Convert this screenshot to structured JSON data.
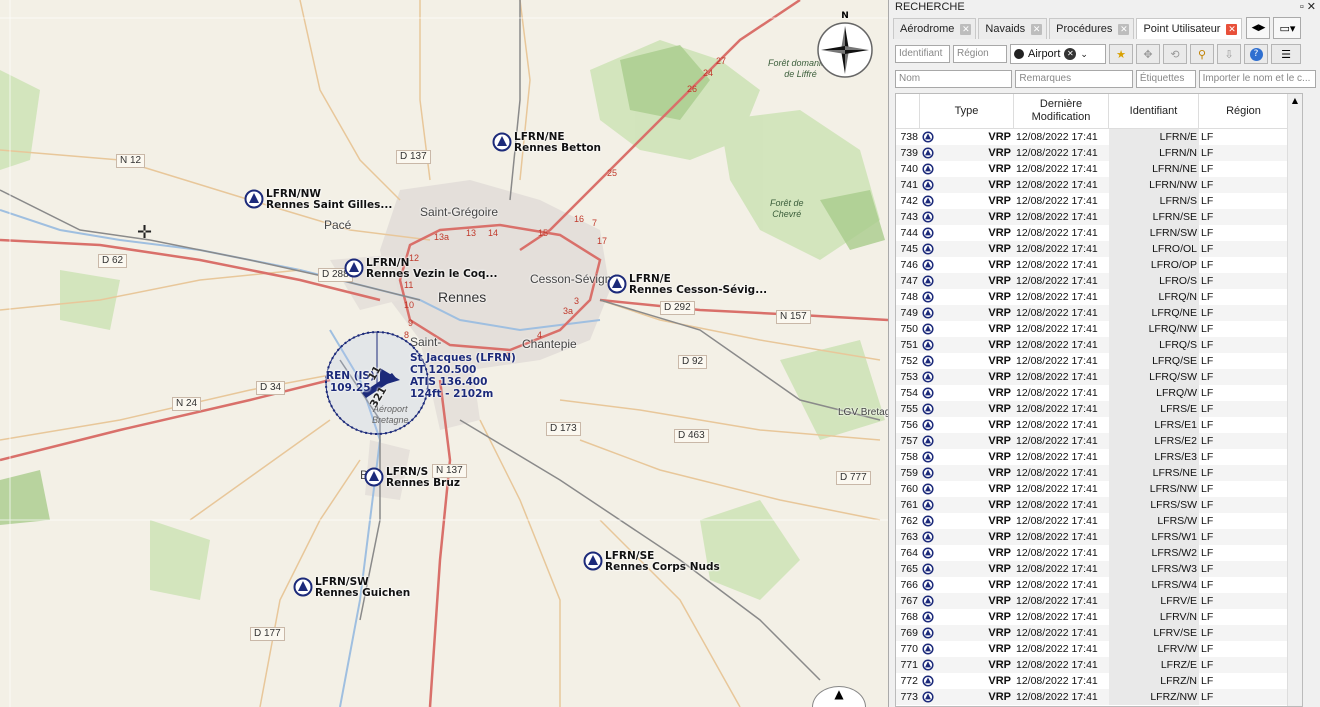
{
  "map": {
    "road_labels": [
      "N 12",
      "D 137",
      "D 62",
      "D 288",
      "D 292",
      "N 157",
      "D 92",
      "D 34",
      "N 24",
      "D 173",
      "D 463",
      "N 137",
      "D 777",
      "D 177"
    ],
    "towns": {
      "pace": "Pacé",
      "saint_gregoire": "Saint-Grégoire",
      "rennes": "Rennes",
      "cesson": "Cesson-Sévigné",
      "chantepie": "Chantepie",
      "saint": "Saint-",
      "lgv": "LGV Bretag",
      "bru": "B"
    },
    "km_markers": [
      "27",
      "26",
      "24",
      "25",
      "16",
      "17",
      "15",
      "14",
      "13",
      "13a",
      "12",
      "11",
      "10",
      "8",
      "9",
      "3",
      "3a",
      "4",
      "5",
      "7"
    ],
    "forests": {
      "liffre": "Forêt domaniale\nde Liffré",
      "chevre": "Forêt de\nChevré"
    },
    "vrp_points": [
      {
        "code": "LFRN/NE",
        "name": "Rennes Betton"
      },
      {
        "code": "LFRN/NW",
        "name": "Rennes Saint Gilles..."
      },
      {
        "code": "LFRN/N",
        "name": "Rennes Vezin le Coq..."
      },
      {
        "code": "LFRN/E",
        "name": "Rennes Cesson-Sévig..."
      },
      {
        "code": "LFRN/S",
        "name": "Rennes Bruz"
      },
      {
        "code": "LFRN/SE",
        "name": "Rennes Corps Nuds"
      },
      {
        "code": "LFRN/SW",
        "name": "Rennes Guichen"
      }
    ],
    "airport": {
      "name": "St Jacques (LFRN)",
      "ct": "CT 120.500",
      "atis": "ATIS 136.400",
      "elev": "124ft - 2102m",
      "navaid_id": "REN (IS)",
      "navaid_freq": "109.25",
      "rwy1": "11",
      "rwy2": "321",
      "area": "Aéroport\nBretagne"
    },
    "compass_label": "N"
  },
  "panel": {
    "title": "RECHERCHE",
    "tabs": [
      {
        "label": "Aérodrome",
        "active": false
      },
      {
        "label": "Navaids",
        "active": false
      },
      {
        "label": "Procédures",
        "active": false
      },
      {
        "label": "Point Utilisateur",
        "active": true
      }
    ],
    "filters": {
      "identifiant_placeholder": "Identifiant",
      "region_placeholder": "Région",
      "type_value": "Airport",
      "nom_placeholder": "Nom",
      "remarques_placeholder": "Remarques",
      "etiquettes_placeholder": "Étiquettes",
      "import_placeholder": "Importer le nom et le c..."
    },
    "table": {
      "headers": {
        "type": "Type",
        "modified": "Dernière\nModification",
        "ident": "Identifiant",
        "region": "Région"
      },
      "rows": [
        {
          "n": "738",
          "type": "VRP",
          "date": "12/08/2022 17:41",
          "id": "LFRN/E",
          "region": "LF"
        },
        {
          "n": "739",
          "type": "VRP",
          "date": "12/08/2022 17:41",
          "id": "LFRN/N",
          "region": "LF"
        },
        {
          "n": "740",
          "type": "VRP",
          "date": "12/08/2022 17:41",
          "id": "LFRN/NE",
          "region": "LF"
        },
        {
          "n": "741",
          "type": "VRP",
          "date": "12/08/2022 17:41",
          "id": "LFRN/NW",
          "region": "LF"
        },
        {
          "n": "742",
          "type": "VRP",
          "date": "12/08/2022 17:41",
          "id": "LFRN/S",
          "region": "LF"
        },
        {
          "n": "743",
          "type": "VRP",
          "date": "12/08/2022 17:41",
          "id": "LFRN/SE",
          "region": "LF"
        },
        {
          "n": "744",
          "type": "VRP",
          "date": "12/08/2022 17:41",
          "id": "LFRN/SW",
          "region": "LF"
        },
        {
          "n": "745",
          "type": "VRP",
          "date": "12/08/2022 17:41",
          "id": "LFRO/OL",
          "region": "LF"
        },
        {
          "n": "746",
          "type": "VRP",
          "date": "12/08/2022 17:41",
          "id": "LFRO/OP",
          "region": "LF"
        },
        {
          "n": "747",
          "type": "VRP",
          "date": "12/08/2022 17:41",
          "id": "LFRO/S",
          "region": "LF"
        },
        {
          "n": "748",
          "type": "VRP",
          "date": "12/08/2022 17:41",
          "id": "LFRQ/N",
          "region": "LF"
        },
        {
          "n": "749",
          "type": "VRP",
          "date": "12/08/2022 17:41",
          "id": "LFRQ/NE",
          "region": "LF"
        },
        {
          "n": "750",
          "type": "VRP",
          "date": "12/08/2022 17:41",
          "id": "LFRQ/NW",
          "region": "LF"
        },
        {
          "n": "751",
          "type": "VRP",
          "date": "12/08/2022 17:41",
          "id": "LFRQ/S",
          "region": "LF"
        },
        {
          "n": "752",
          "type": "VRP",
          "date": "12/08/2022 17:41",
          "id": "LFRQ/SE",
          "region": "LF"
        },
        {
          "n": "753",
          "type": "VRP",
          "date": "12/08/2022 17:41",
          "id": "LFRQ/SW",
          "region": "LF"
        },
        {
          "n": "754",
          "type": "VRP",
          "date": "12/08/2022 17:41",
          "id": "LFRQ/W",
          "region": "LF"
        },
        {
          "n": "755",
          "type": "VRP",
          "date": "12/08/2022 17:41",
          "id": "LFRS/E",
          "region": "LF"
        },
        {
          "n": "756",
          "type": "VRP",
          "date": "12/08/2022 17:41",
          "id": "LFRS/E1",
          "region": "LF"
        },
        {
          "n": "757",
          "type": "VRP",
          "date": "12/08/2022 17:41",
          "id": "LFRS/E2",
          "region": "LF"
        },
        {
          "n": "758",
          "type": "VRP",
          "date": "12/08/2022 17:41",
          "id": "LFRS/E3",
          "region": "LF"
        },
        {
          "n": "759",
          "type": "VRP",
          "date": "12/08/2022 17:41",
          "id": "LFRS/NE",
          "region": "LF"
        },
        {
          "n": "760",
          "type": "VRP",
          "date": "12/08/2022 17:41",
          "id": "LFRS/NW",
          "region": "LF"
        },
        {
          "n": "761",
          "type": "VRP",
          "date": "12/08/2022 17:41",
          "id": "LFRS/SW",
          "region": "LF"
        },
        {
          "n": "762",
          "type": "VRP",
          "date": "12/08/2022 17:41",
          "id": "LFRS/W",
          "region": "LF"
        },
        {
          "n": "763",
          "type": "VRP",
          "date": "12/08/2022 17:41",
          "id": "LFRS/W1",
          "region": "LF"
        },
        {
          "n": "764",
          "type": "VRP",
          "date": "12/08/2022 17:41",
          "id": "LFRS/W2",
          "region": "LF"
        },
        {
          "n": "765",
          "type": "VRP",
          "date": "12/08/2022 17:41",
          "id": "LFRS/W3",
          "region": "LF"
        },
        {
          "n": "766",
          "type": "VRP",
          "date": "12/08/2022 17:41",
          "id": "LFRS/W4",
          "region": "LF"
        },
        {
          "n": "767",
          "type": "VRP",
          "date": "12/08/2022 17:41",
          "id": "LFRV/E",
          "region": "LF"
        },
        {
          "n": "768",
          "type": "VRP",
          "date": "12/08/2022 17:41",
          "id": "LFRV/N",
          "region": "LF"
        },
        {
          "n": "769",
          "type": "VRP",
          "date": "12/08/2022 17:41",
          "id": "LFRV/SE",
          "region": "LF"
        },
        {
          "n": "770",
          "type": "VRP",
          "date": "12/08/2022 17:41",
          "id": "LFRV/W",
          "region": "LF"
        },
        {
          "n": "771",
          "type": "VRP",
          "date": "12/08/2022 17:41",
          "id": "LFRZ/E",
          "region": "LF"
        },
        {
          "n": "772",
          "type": "VRP",
          "date": "12/08/2022 17:41",
          "id": "LFRZ/N",
          "region": "LF"
        },
        {
          "n": "773",
          "type": "VRP",
          "date": "12/08/2022 17:41",
          "id": "LFRZ/NW",
          "region": "LF"
        }
      ]
    }
  }
}
